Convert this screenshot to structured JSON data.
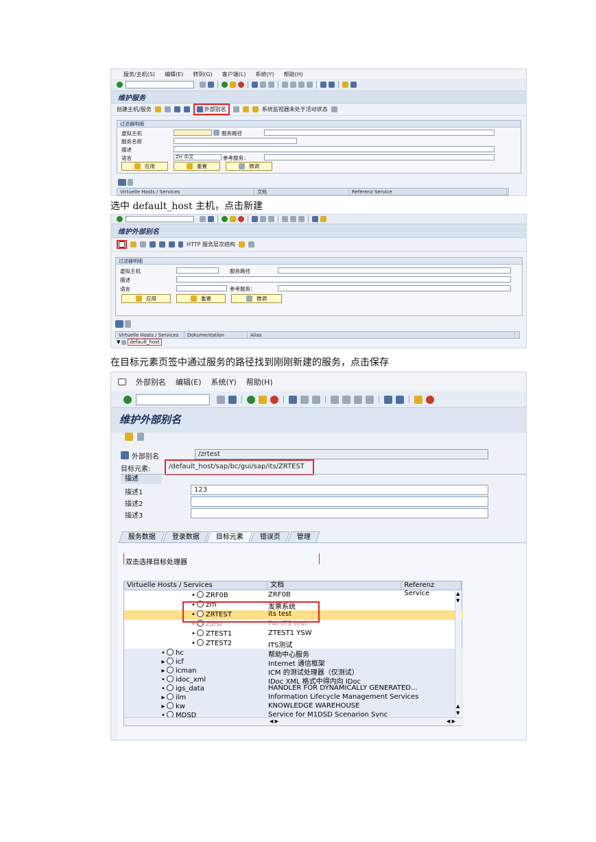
{
  "captions": [
    "选中 default_host 主机，点击新建",
    "在目标元素页签中通过服务的路径找到刚刚新建的服务，点击保存"
  ],
  "screen1": {
    "menu": [
      "服务/主机(S)",
      "编辑(E)",
      "转到(G)",
      "客户端(L)",
      "系统(Y)",
      "帮助(H)"
    ],
    "title": "维护服务",
    "app_toolbar": {
      "create_host": "创建主机/服务",
      "external_alias": "外部别名",
      "system_monitor": "系统监视器未处于活动状态"
    },
    "filter_title": "过滤器明细",
    "fields": {
      "virtual_host": "虚拟主机",
      "service_path": "服务路径",
      "service_name": "服务名称",
      "description": "描述",
      "language": "语言",
      "language_value": "ZH 中文",
      "ref_service": "参考服务："
    },
    "buttons": {
      "apply": "应用",
      "reset": "重置",
      "fine": "微调"
    },
    "grid_headers": [
      "Virtuelle Hosts / Services",
      "文档",
      "Referenz Service"
    ]
  },
  "screen2": {
    "title": "维护外部别名",
    "app_toolbar": {
      "http_hierarchy": "HTTP 服务层次结构"
    },
    "filter_title": "过滤器明细",
    "fields": {
      "virtual_host": "虚拟主机",
      "service_path": "服务路径",
      "description": "描述",
      "language": "语言",
      "ref_service": "参考服务："
    },
    "buttons": {
      "apply": "应用",
      "reset": "重置",
      "fine": "微调"
    },
    "grid_headers": [
      "Virtuelle Hosts / Services",
      "Dokumentation",
      "Alias"
    ],
    "tree_node": "default_host"
  },
  "screen3": {
    "menu": [
      "外部别名",
      "编辑(E)",
      "系统(Y)",
      "帮助(H)"
    ],
    "title": "维护外部别名",
    "external_alias_label": "外部别名",
    "external_alias_value": "/zrtest",
    "target_label": "目标元素:",
    "target_value": "/default_host/sap/bc/gui/sap/its/ZRTEST",
    "desc_header": "描述",
    "desc1_label": "描述1",
    "desc1_value": "123",
    "desc2_label": "描述2",
    "desc3_label": "描述3",
    "tabs": [
      "服务数据",
      "登录数据",
      "目标元素",
      "错误页",
      "管理"
    ],
    "active_tab": 2,
    "hint": "双击选择目标处理器",
    "tree_headers": [
      "Virtuelle Hosts / Services",
      "文档",
      "Referenz Service"
    ],
    "tree_rows_upper": [
      {
        "name": "ZRF0B",
        "doc": "ZRF0B"
      },
      {
        "name": "zrfi",
        "doc": "发票系统"
      },
      {
        "name": "ZRTEST",
        "doc": "its test"
      },
      {
        "name": "ztest",
        "doc": "For ITS test"
      },
      {
        "name": "ZTEST1",
        "doc": "ZTEST1 YSW"
      },
      {
        "name": "ZTEST2",
        "doc": "ITS测试"
      }
    ],
    "tree_rows_lower": [
      {
        "name": "hc",
        "doc": "帮助中心服务"
      },
      {
        "name": "icf",
        "doc": "Internet 通信框架"
      },
      {
        "name": "icman",
        "doc": "ICM 的测试处理器（仅测试）"
      },
      {
        "name": "idoc_xml",
        "doc": "IDoc XML 格式中得内向 IDoc"
      },
      {
        "name": "igs_data",
        "doc": "HANDLER FOR DYNAMICALLY GENERATED..."
      },
      {
        "name": "ilm",
        "doc": "Information Lifecycle Management Services"
      },
      {
        "name": "kw",
        "doc": "KNOWLEDGE WAREHOUSE"
      },
      {
        "name": "MDSD",
        "doc": "Service for M1DSD Scenarion Sync"
      }
    ]
  }
}
